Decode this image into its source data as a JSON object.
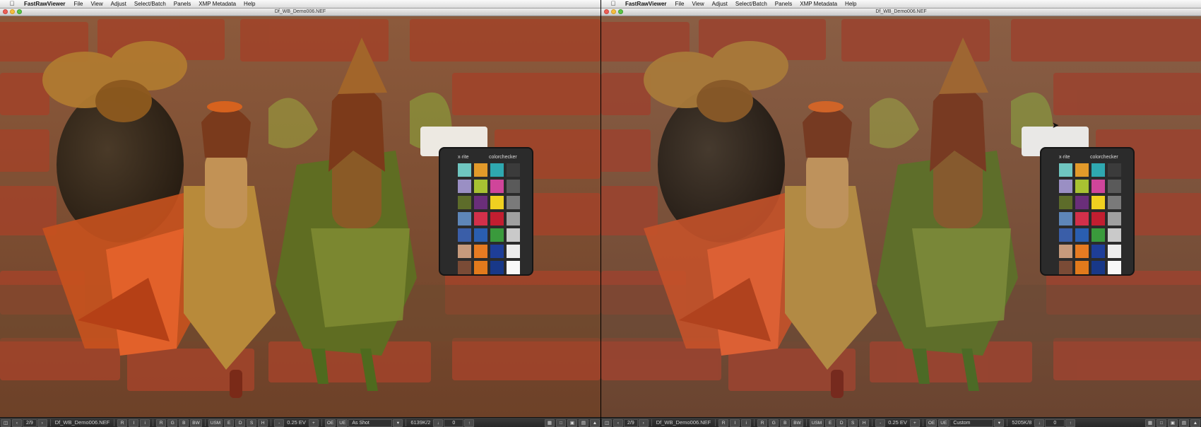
{
  "menubar": {
    "app_name": "FastRawViewer",
    "items": [
      "File",
      "View",
      "Adjust",
      "Select/Batch",
      "Panels",
      "XMP Metadata",
      "Help"
    ]
  },
  "window": {
    "title": "Df_WB_Demo006.NEF"
  },
  "colors": {
    "brick": "#a6452c",
    "mortar": "#8a6e4e",
    "leaf_orange": "#d4501c",
    "dress_green": "#6e7a2c",
    "checker_body": "#2b2b2b"
  },
  "checker": {
    "brand": "x·rite",
    "name": "colorchecker",
    "swatches": [
      "#6fc6c0",
      "#e29a2a",
      "#2fa8b0",
      "#3b3b3b",
      "#9a8fc4",
      "#a8c232",
      "#d0459a",
      "#5a5a5a",
      "#5d6c2a",
      "#6a2e7a",
      "#f0d020",
      "#7a7a7a",
      "#5e86b8",
      "#d2304a",
      "#c21e30",
      "#a0a0a0",
      "#3a5ea8",
      "#2a5eb0",
      "#3a9a3c",
      "#c9c9c9",
      "#c69a7c",
      "#e67b22",
      "#1e3e98",
      "#ececec",
      "#7a4b36",
      "#e27a1c",
      "#183888",
      "#f8f8f8"
    ]
  },
  "left": {
    "status": {
      "counter": "2/9",
      "filename": "Df_WB_Demo006.NEF",
      "r": "R",
      "i": "I",
      "info": "i",
      "rgb": [
        "R",
        "G",
        "B",
        "BW"
      ],
      "usm": "USM",
      "ehsh": [
        "E",
        "D",
        "S",
        "H"
      ],
      "ev_minus": "-",
      "ev": "0.25 EV",
      "ev_plus": "+",
      "oe": "OE",
      "ue": "UE",
      "wb": "As Shot",
      "temp": "6139K/2",
      "rotate_value": "0"
    }
  },
  "right": {
    "status": {
      "counter": "2/9",
      "filename": "Df_WB_Demo006.NEF",
      "r": "R",
      "i": "I",
      "info": "i",
      "rgb": [
        "R",
        "G",
        "B",
        "BW"
      ],
      "usm": "USM",
      "ehsh": [
        "E",
        "D",
        "S",
        "H"
      ],
      "ev_minus": "-",
      "ev": "0.25 EV",
      "ev_plus": "+",
      "oe": "OE",
      "ue": "UE",
      "wb": "Custom",
      "temp": "5205K/8",
      "rotate_value": "0"
    }
  },
  "icons": {
    "apple": "apple-icon",
    "prev": "chevron-left-icon",
    "next": "chevron-right-icon",
    "rotate_down": "arrow-down-icon",
    "rotate_up": "arrow-up-icon",
    "grid": "grid-icon",
    "cursor": "cursor-icon"
  }
}
